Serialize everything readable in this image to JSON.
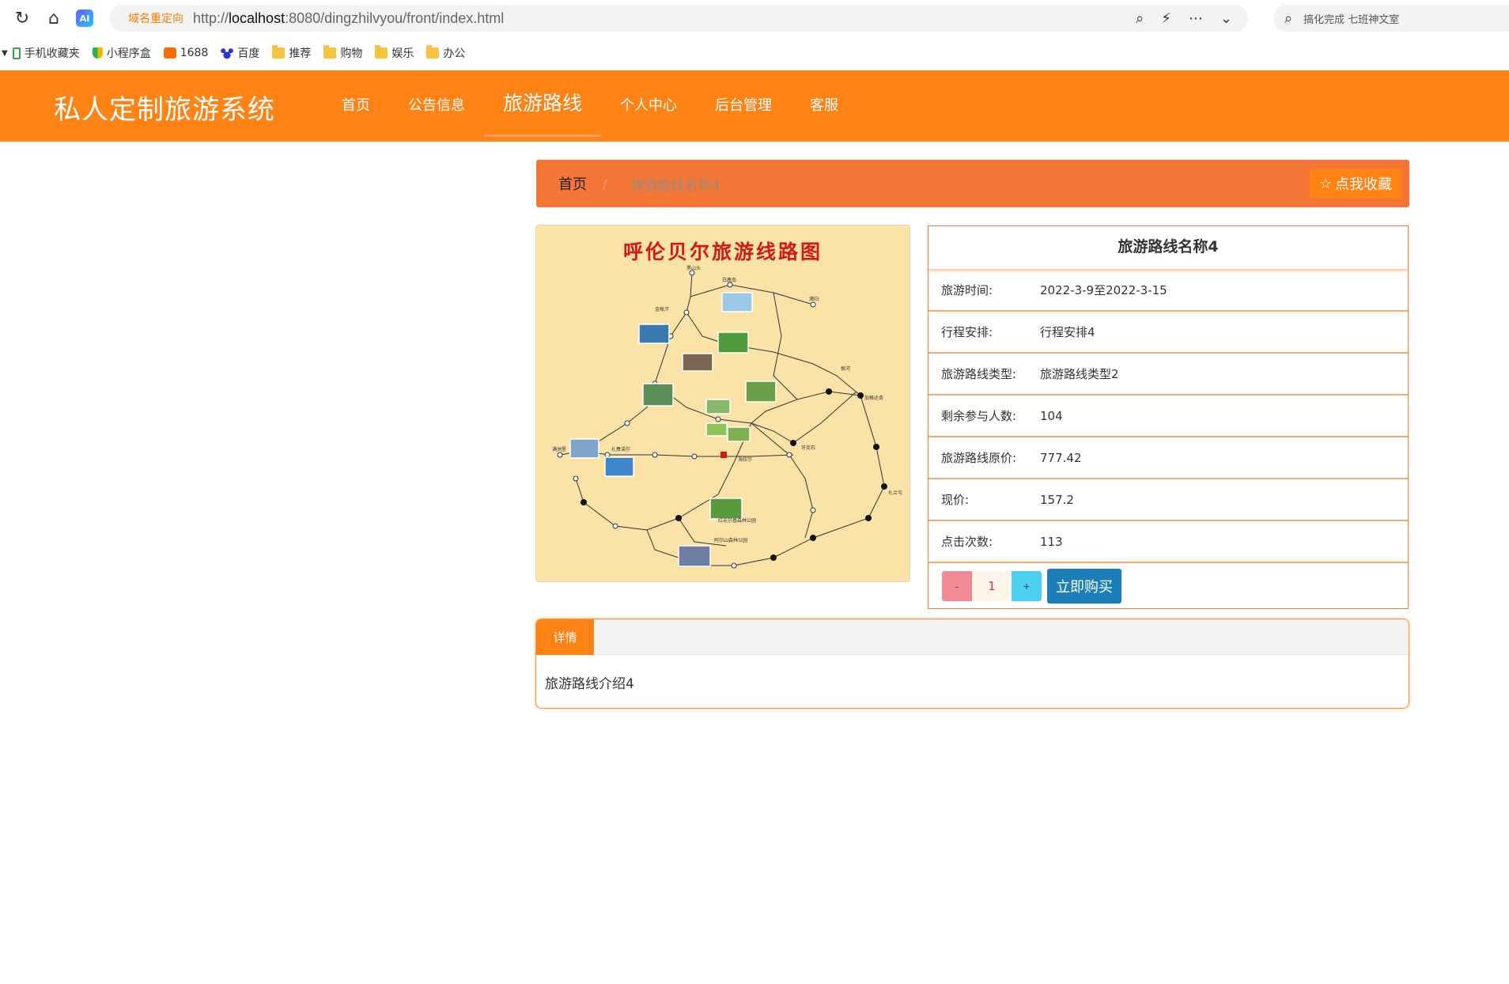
{
  "browser": {
    "address_tag": "域名重定向",
    "url_prefix": "http://",
    "url_host": "localhost",
    "url_rest": ":8080/dingzhilvyou/front/index.html",
    "search_placeholder": "搞化完成 七班神文室",
    "ai_label": "AI",
    "bookmarks": [
      "手机收藏夹",
      "小程序盒",
      "1688",
      "百度",
      "推荐",
      "购物",
      "娱乐",
      "办公"
    ]
  },
  "site": {
    "title": "私人定制旅游系统",
    "nav": [
      "首页",
      "公告信息",
      "旅游路线",
      "个人中心",
      "后台管理",
      "客服"
    ],
    "active_nav": "旅游路线"
  },
  "breadcrumb": {
    "home": "首页",
    "separator": "/",
    "current": "旅游路线名称4",
    "favorite_label": "点我收藏"
  },
  "map": {
    "title": "呼伦贝尔旅游线路图",
    "colors": {
      "background": "#fbe3a7",
      "title": "#d11a12"
    }
  },
  "product": {
    "name": "旅游路线名称4",
    "fields": [
      {
        "label": "旅游时间:",
        "value": "2022-3-9至2022-3-15"
      },
      {
        "label": "行程安排:",
        "value": "行程安排4"
      },
      {
        "label": "旅游路线类型:",
        "value": "旅游路线类型2"
      },
      {
        "label": "剩余参与人数:",
        "value": "104"
      },
      {
        "label": "旅游路线原价:",
        "value": "777.42"
      },
      {
        "label": "现价:",
        "value": "157.2"
      },
      {
        "label": "点击次数:",
        "value": "113"
      }
    ],
    "quantity": "1",
    "minus_label": "-",
    "plus_label": "+",
    "buy_label": "立即购买"
  },
  "detail": {
    "tab_label": "详情",
    "content": "旅游路线介绍4"
  },
  "colors": {
    "brand": "#ff8214",
    "breadcrumb": "#f57536",
    "buy_button": "#1c7fb8",
    "minus_button": "#f08a95",
    "plus_button": "#4dcff3"
  }
}
